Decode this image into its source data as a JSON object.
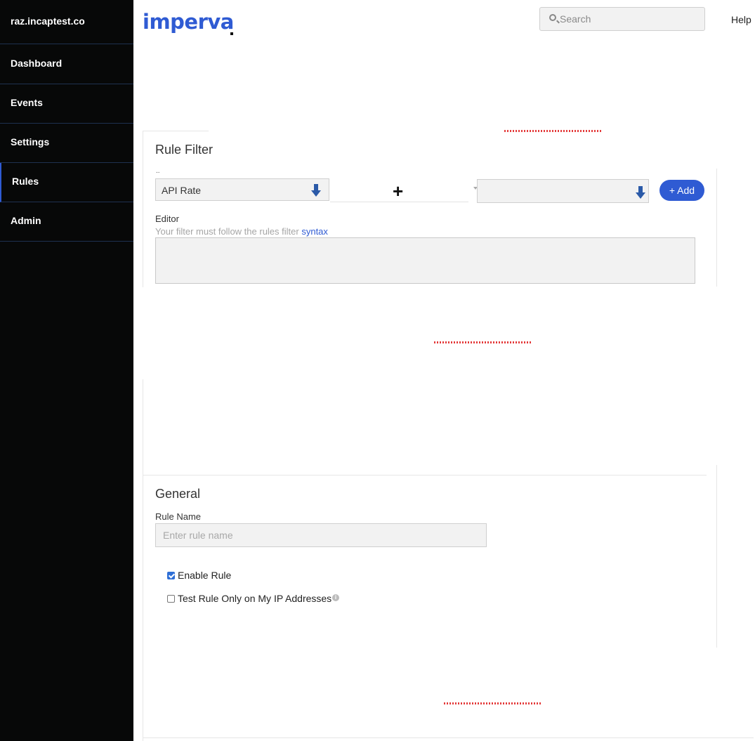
{
  "sidebar": {
    "account": "raz.incaptest.co",
    "items": [
      {
        "label": "Dashboard"
      },
      {
        "label": "Events"
      },
      {
        "label": "Settings"
      },
      {
        "label": "Rules",
        "active": true
      },
      {
        "label": "Admin"
      }
    ]
  },
  "header": {
    "logo": "imperva",
    "search_placeholder": "Search",
    "help": "Help"
  },
  "rule_filter": {
    "title": "Rule Filter",
    "small_label": "..",
    "attribute_value": "API Rate",
    "operator_symbol": "+",
    "add_label": "+ Add",
    "editor_label": "Editor",
    "editor_hint": "Your filter must follow the rules filter",
    "editor_hint_link": "syntax"
  },
  "general": {
    "title": "General",
    "rule_name_label": "Rule Name",
    "rule_name_placeholder": "Enter rule name",
    "enable_rule_label": "Enable Rule",
    "enable_rule_checked": true,
    "test_rule_label": "Test Rule Only on My IP Addresses",
    "test_rule_checked": false
  },
  "colors": {
    "sidebar_bg": "#070808",
    "accent": "#2f5bd3",
    "divider": "#1e3150"
  }
}
